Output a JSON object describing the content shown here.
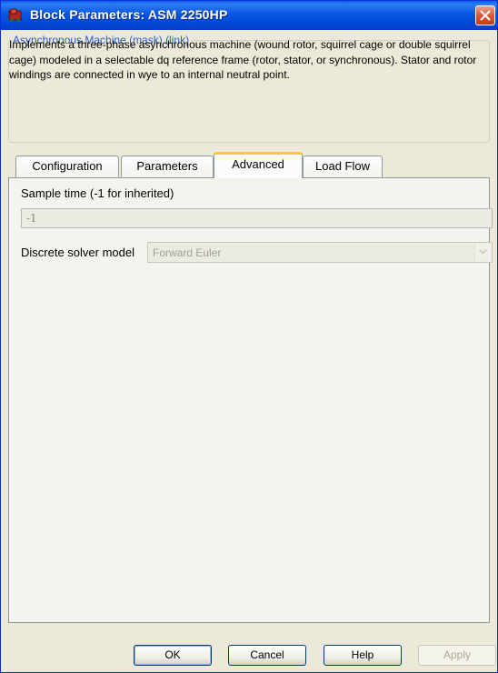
{
  "window": {
    "title": "Block Parameters: ASM 2250HP",
    "icon": "simulink-block-icon",
    "close_icon": "close-icon"
  },
  "description": {
    "legend": "Asynchronous Machine (mask) (link)",
    "text": "Implements a three-phase asynchronous machine (wound rotor, squirrel cage or double squirrel cage) modeled in a selectable dq reference frame (rotor, stator, or synchronous). Stator and rotor windings are connected in wye to an internal neutral point."
  },
  "tabs": [
    {
      "label": "Configuration",
      "active": false
    },
    {
      "label": "Parameters",
      "active": false
    },
    {
      "label": "Advanced",
      "active": true
    },
    {
      "label": "Load Flow",
      "active": false
    }
  ],
  "advanced": {
    "sample_time_label": "Sample time (-1 for inherited)",
    "sample_time_value": "-1",
    "solver_label": "Discrete solver model",
    "solver_value": "Forward Euler"
  },
  "buttons": {
    "ok": "OK",
    "cancel": "Cancel",
    "help": "Help",
    "apply": "Apply"
  }
}
